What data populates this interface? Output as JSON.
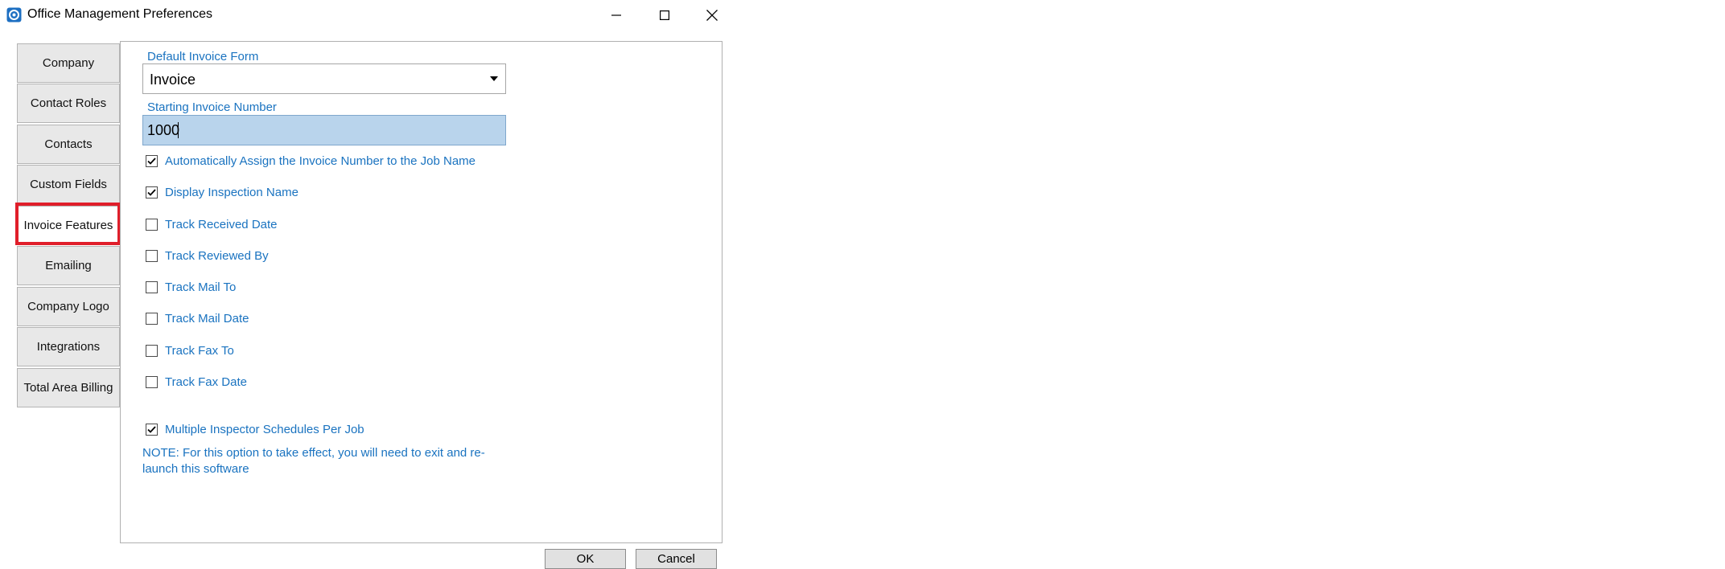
{
  "window": {
    "title": "Office Management Preferences",
    "app_icon": "app-logo-icon",
    "controls": {
      "minimize": "minimize-icon",
      "maximize": "maximize-icon",
      "close": "close-icon"
    }
  },
  "tabs": [
    {
      "label": "Company",
      "selected": false
    },
    {
      "label": "Contact Roles",
      "selected": false
    },
    {
      "label": "Contacts",
      "selected": false
    },
    {
      "label": "Custom Fields",
      "selected": false
    },
    {
      "label": "Invoice Features",
      "selected": true
    },
    {
      "label": "Emailing",
      "selected": false
    },
    {
      "label": "Company Logo",
      "selected": false
    },
    {
      "label": "Integrations",
      "selected": false
    },
    {
      "label": "Total Area Billing",
      "selected": false
    }
  ],
  "form": {
    "default_invoice_form": {
      "label": "Default Invoice Form",
      "value": "Invoice"
    },
    "starting_invoice_number": {
      "label": "Starting Invoice Number",
      "value": "1000"
    },
    "checkboxes": [
      {
        "label": "Automatically Assign the Invoice Number to the Job Name",
        "checked": true
      },
      {
        "label": "Display Inspection Name",
        "checked": true
      },
      {
        "label": "Track Received Date",
        "checked": false
      },
      {
        "label": "Track Reviewed By",
        "checked": false
      },
      {
        "label": "Track Mail To",
        "checked": false
      },
      {
        "label": "Track Mail Date",
        "checked": false
      },
      {
        "label": "Track Fax To",
        "checked": false
      },
      {
        "label": "Track Fax Date",
        "checked": false
      },
      {
        "label": "Multiple Inspector Schedules Per Job",
        "checked": true
      }
    ],
    "note": "NOTE:  For this option to take effect, you will need to exit and re-launch this software"
  },
  "buttons": {
    "ok": "OK",
    "cancel": "Cancel"
  },
  "colors": {
    "label_blue": "#1a73c0",
    "highlight_red": "#e01e2a",
    "input_selected_bg": "#b9d4ec"
  }
}
